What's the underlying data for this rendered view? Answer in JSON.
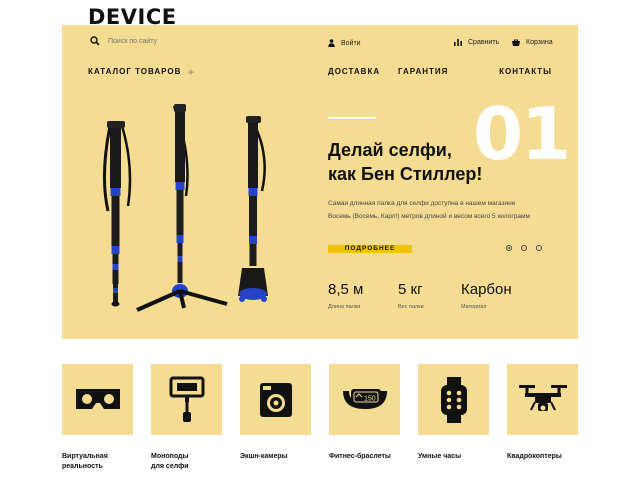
{
  "header": {
    "logo": "DEVICE",
    "search_placeholder": "Поиск по сайту",
    "login": "Войти",
    "compare": "Сравнить",
    "cart": "Корзина"
  },
  "nav": {
    "catalog": "КАТАЛОГ ТОВАРОВ",
    "delivery": "ДОСТАВКА",
    "guarantee": "ГАРАНТИЯ",
    "contacts": "КОНТАКТЫ"
  },
  "slider": {
    "number": "01",
    "title_line1": "Делай селфи,",
    "title_line2": "как Бен Стиллер!",
    "desc_line1": "Самая длинная палка для селфи доступна в нашем магазине",
    "desc_line2": "Восемь (Восемь, Карл!) метров длиной и весом всего 5 килограмм",
    "more": "ПОДРОБНЕЕ",
    "active_slide": 1,
    "slide_count": 3
  },
  "specs": [
    {
      "value": "8,5 м",
      "label": "Длина палки"
    },
    {
      "value": "5 кг",
      "label": "Вес палки"
    },
    {
      "value": "Карбон",
      "label": "Материал"
    }
  ],
  "categories": [
    {
      "line1": "Виртуальная",
      "line2": "реальность",
      "icon": "vr-headset-icon"
    },
    {
      "line1": "Моноподы",
      "line2": "для селфи",
      "icon": "selfie-stick-icon"
    },
    {
      "line1": "Экшн-камеры",
      "line2": "",
      "icon": "action-camera-icon"
    },
    {
      "line1": "Фитнес-браслеты",
      "line2": "",
      "icon": "fitness-band-icon",
      "band_display": "150"
    },
    {
      "line1": "Умные часы",
      "line2": "",
      "icon": "smart-watch-icon"
    },
    {
      "line1": "Квадрокоптеры",
      "line2": "",
      "icon": "quadcopter-icon"
    }
  ],
  "colors": {
    "accent": "#f4dc93",
    "button": "#f1c200",
    "text": "#111111"
  }
}
